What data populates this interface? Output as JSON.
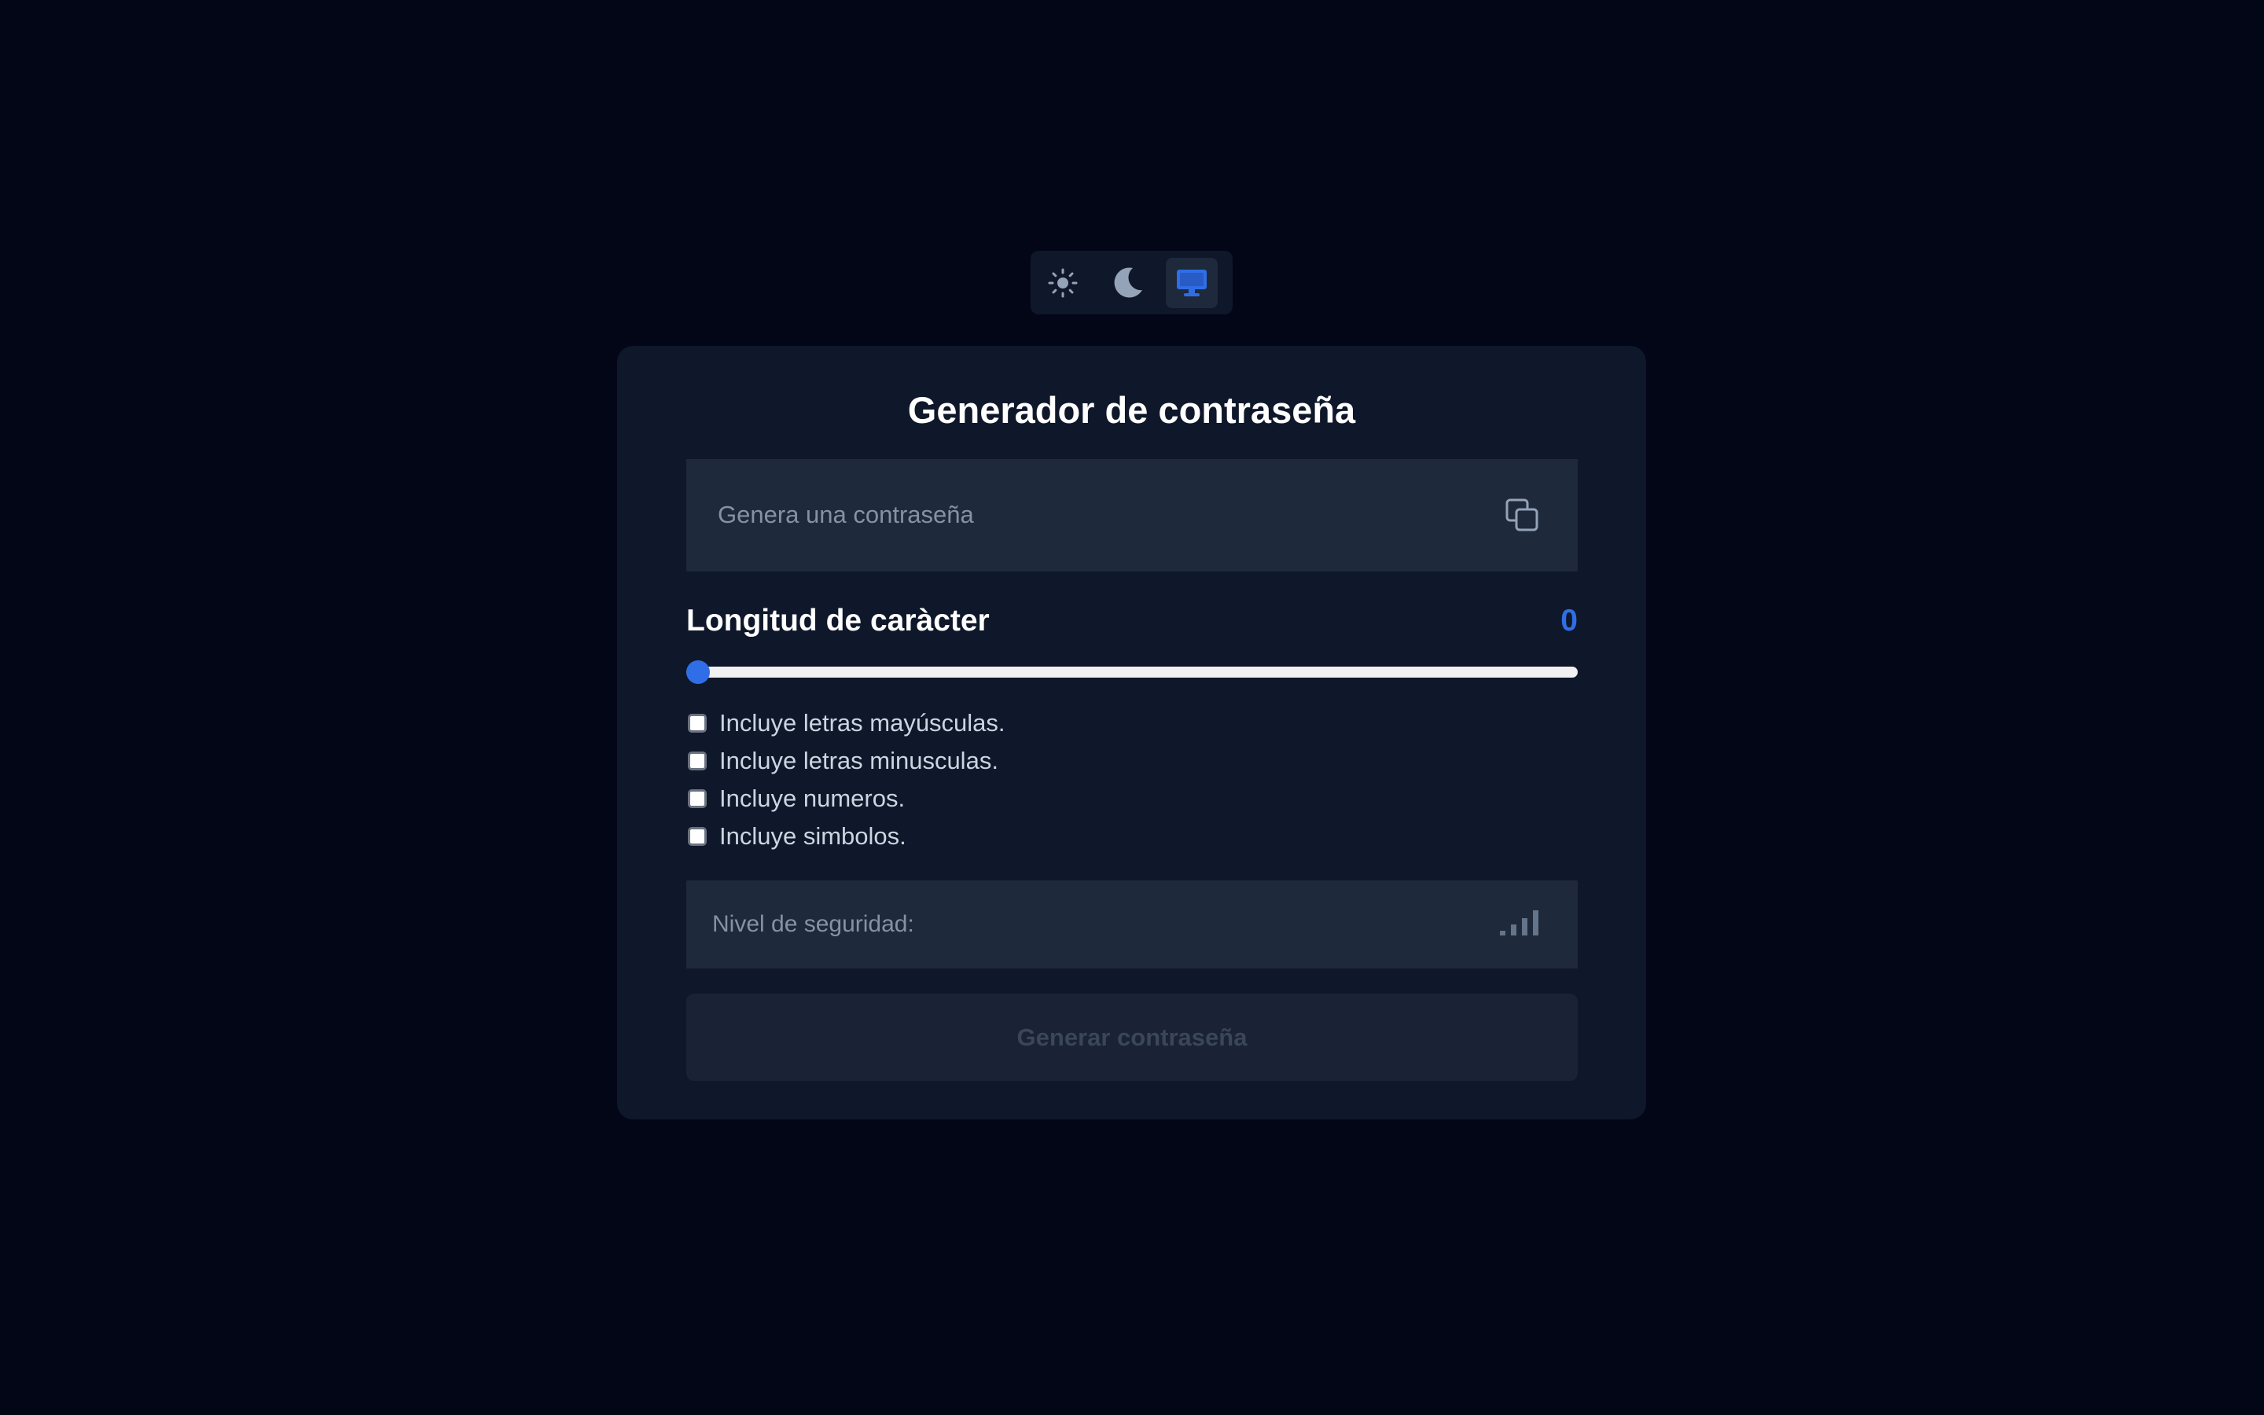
{
  "theme_switcher": {
    "options": [
      {
        "icon": "sun-icon",
        "label": "light"
      },
      {
        "icon": "moon-icon",
        "label": "dark"
      },
      {
        "icon": "monitor-icon",
        "label": "system",
        "active": true
      }
    ],
    "active_color": "#2f6ee6"
  },
  "card": {
    "title": "Generador de contraseña",
    "password_field": {
      "value": "",
      "placeholder": "Genera una contraseña",
      "copy_icon": "copy-icon"
    },
    "length": {
      "label": "Longitud de caràcter",
      "value": "0",
      "slider_fraction": 0
    },
    "options": [
      {
        "label": "Incluye letras mayúsculas.",
        "checked": false
      },
      {
        "label": "Incluye letras minusculas.",
        "checked": false
      },
      {
        "label": "Incluye numeros.",
        "checked": false
      },
      {
        "label": "Incluye simbolos.",
        "checked": false
      }
    ],
    "security": {
      "label": "Nivel de seguridad:",
      "icon": "signal-bars-icon"
    },
    "generate_button": {
      "label": "Generar contraseña",
      "disabled": true
    }
  },
  "colors": {
    "background": "#020617",
    "card": "#0f172a",
    "field": "#1e293b",
    "accent": "#2f6ee6"
  }
}
